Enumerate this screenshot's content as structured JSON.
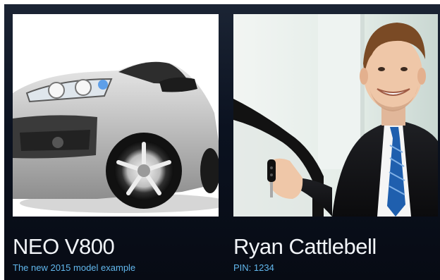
{
  "tiles": [
    {
      "title": "NEO V800",
      "subtitle": "The new 2015 model example",
      "image": "car-photo"
    },
    {
      "title": "Ryan Cattlebell",
      "subtitle": "PIN: 1234",
      "image": "salesman-photo"
    }
  ],
  "colors": {
    "background": "#0b1220",
    "title_text": "#f1f4f8",
    "subtitle_text": "#62b8ee"
  }
}
